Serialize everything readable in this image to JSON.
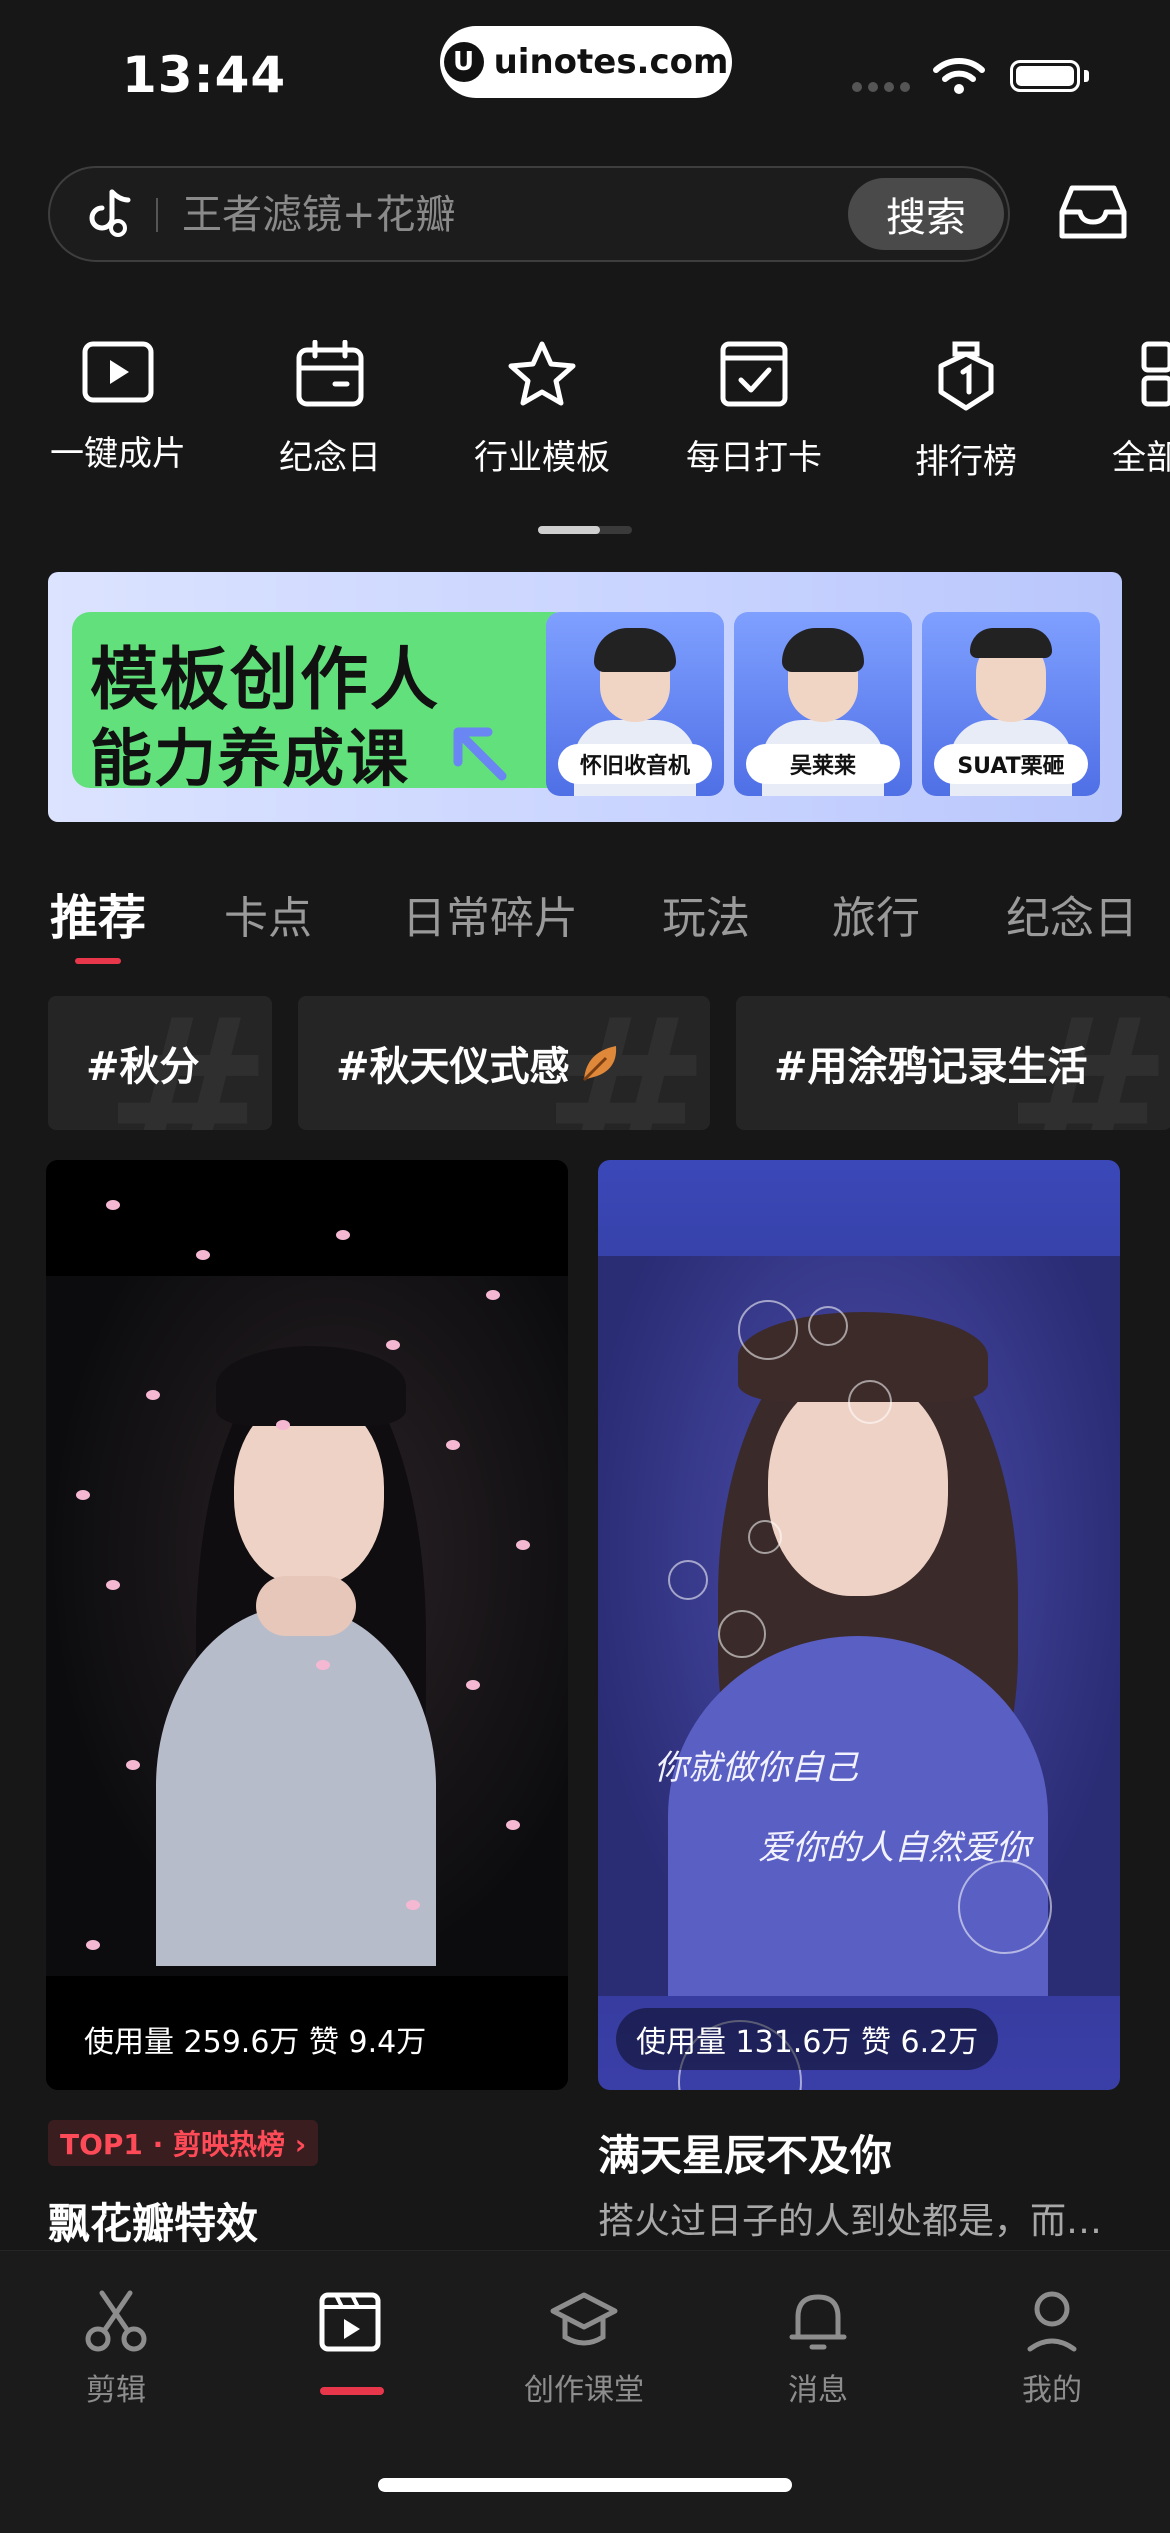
{
  "status_bar": {
    "time": "13:44",
    "watermark": "uinotes.com"
  },
  "search": {
    "placeholder": "王者滤镜+花瓣",
    "button": "搜索"
  },
  "quick_actions": [
    {
      "label": "一键成片",
      "icon": "play-square-icon"
    },
    {
      "label": "纪念日",
      "icon": "calendar-icon"
    },
    {
      "label": "行业模板",
      "icon": "star-icon"
    },
    {
      "label": "每日打卡",
      "icon": "checkin-icon"
    },
    {
      "label": "排行榜",
      "icon": "medal-icon"
    },
    {
      "label": "全部",
      "icon": "grid-icon"
    }
  ],
  "banner": {
    "title_line1": "模板创作人",
    "title_line2": "能力养成课",
    "teachers": [
      "怀旧收音机",
      "吴莱莱",
      "SUAT栗砸"
    ]
  },
  "tabs": [
    "推荐",
    "卡点",
    "日常碎片",
    "玩法",
    "旅行",
    "纪念日"
  ],
  "hashtags": [
    "#秋分",
    "#秋天仪式感",
    "#用涂鸦记录生活"
  ],
  "cards": [
    {
      "stats": "使用量 259.6万 赞 9.4万",
      "badge": "TOP1 · 剪映热榜 ›",
      "title": "飘花瓣特效"
    },
    {
      "stats": "使用量 131.6万 赞 6.2万",
      "title": "满天星辰不及你",
      "description": "搭火过日子的人到处都是，而…",
      "overlay_line1": "你就做你自己",
      "overlay_line2": "爱你的人自然爱你"
    }
  ],
  "bottom_nav": [
    {
      "label": "剪辑",
      "icon": "scissors-icon"
    },
    {
      "label": "",
      "icon": "template-icon"
    },
    {
      "label": "创作课堂",
      "icon": "graduation-cap-icon"
    },
    {
      "label": "消息",
      "icon": "bell-icon"
    },
    {
      "label": "我的",
      "icon": "profile-icon"
    }
  ],
  "colors": {
    "background": "#171717",
    "accent": "#e8374b",
    "banner_green": "#62e07c",
    "banner_blue": "#c8d3ff"
  }
}
